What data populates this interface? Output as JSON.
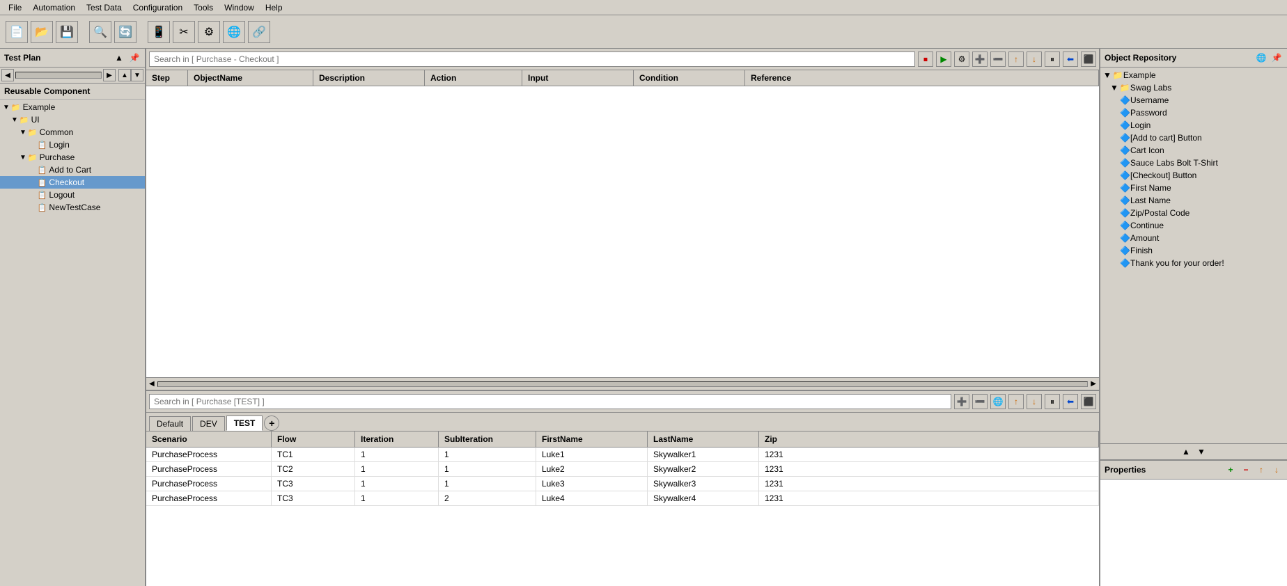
{
  "menu": {
    "items": [
      "File",
      "Automation",
      "Test Data",
      "Configuration",
      "Tools",
      "Window",
      "Help"
    ]
  },
  "toolbar": {
    "buttons": [
      "new",
      "open",
      "save",
      "magnify",
      "refresh",
      "device",
      "crop",
      "gear",
      "globe",
      "link"
    ]
  },
  "left_panel": {
    "title": "Test Plan",
    "label": "Reusable Component",
    "tree": [
      {
        "id": "example",
        "label": "Example",
        "level": 0,
        "type": "folder",
        "expand": true
      },
      {
        "id": "ui",
        "label": "UI",
        "level": 1,
        "type": "folder",
        "expand": true
      },
      {
        "id": "common",
        "label": "Common",
        "level": 2,
        "type": "folder",
        "expand": true
      },
      {
        "id": "login",
        "label": "Login",
        "level": 3,
        "type": "page"
      },
      {
        "id": "purchase",
        "label": "Purchase",
        "level": 2,
        "type": "folder",
        "expand": true
      },
      {
        "id": "addtocart",
        "label": "Add to Cart",
        "level": 3,
        "type": "page"
      },
      {
        "id": "checkout",
        "label": "Checkout",
        "level": 3,
        "type": "case",
        "selected": true
      },
      {
        "id": "logout",
        "label": "Logout",
        "level": 3,
        "type": "page"
      },
      {
        "id": "newtestcase",
        "label": "NewTestCase",
        "level": 3,
        "type": "page"
      }
    ]
  },
  "upper_section": {
    "search_placeholder": "Search in [",
    "search_context": "Purchase - Checkout",
    "search_context_suffix": " ]",
    "columns": [
      "Step",
      "ObjectName",
      "Description",
      "Action",
      "Input",
      "Condition",
      "Reference"
    ],
    "rows": []
  },
  "lower_section": {
    "search_placeholder": "Search in [",
    "search_context": "Purchase [TEST]",
    "search_context_suffix": " ]",
    "tabs": [
      {
        "label": "Default",
        "active": false
      },
      {
        "label": "DEV",
        "active": false
      },
      {
        "label": "TEST",
        "active": true
      }
    ],
    "columns": [
      "Scenario",
      "Flow",
      "Iteration",
      "SubIteration",
      "FirstName",
      "LastName",
      "Zip"
    ],
    "rows": [
      {
        "scenario": "PurchaseProcess",
        "flow": "TC1",
        "iteration": "1",
        "subiteration": "1",
        "firstname": "Luke1",
        "lastname": "Skywalker1",
        "zip": "1231"
      },
      {
        "scenario": "PurchaseProcess",
        "flow": "TC2",
        "iteration": "1",
        "subiteration": "1",
        "firstname": "Luke2",
        "lastname": "Skywalker2",
        "zip": "1231"
      },
      {
        "scenario": "PurchaseProcess",
        "flow": "TC3",
        "iteration": "1",
        "subiteration": "1",
        "firstname": "Luke3",
        "lastname": "Skywalker3",
        "zip": "1231"
      },
      {
        "scenario": "PurchaseProcess",
        "flow": "TC3",
        "iteration": "1",
        "subiteration": "2",
        "firstname": "Luke4",
        "lastname": "Skywalker4",
        "zip": "1231"
      }
    ]
  },
  "right_panel": {
    "title": "Object Repository",
    "tree": [
      {
        "label": "Example",
        "level": 0,
        "type": "folder",
        "expand": true
      },
      {
        "label": "Swag Labs",
        "level": 1,
        "type": "folder",
        "expand": true
      },
      {
        "label": "Username",
        "level": 2,
        "type": "obj"
      },
      {
        "label": "Password",
        "level": 2,
        "type": "obj"
      },
      {
        "label": "Login",
        "level": 2,
        "type": "obj"
      },
      {
        "label": "[Add to cart] Button",
        "level": 2,
        "type": "obj"
      },
      {
        "label": "Cart Icon",
        "level": 2,
        "type": "obj"
      },
      {
        "label": "Sauce Labs Bolt T-Shirt",
        "level": 2,
        "type": "obj"
      },
      {
        "label": "[Checkout] Button",
        "level": 2,
        "type": "obj"
      },
      {
        "label": "First Name",
        "level": 2,
        "type": "obj"
      },
      {
        "label": "Last Name",
        "level": 2,
        "type": "obj"
      },
      {
        "label": "Zip/Postal Code",
        "level": 2,
        "type": "obj"
      },
      {
        "label": "Continue",
        "level": 2,
        "type": "obj"
      },
      {
        "label": "Amount",
        "level": 2,
        "type": "obj"
      },
      {
        "label": "Finish",
        "level": 2,
        "type": "obj"
      },
      {
        "label": "Thank you for your order!",
        "level": 2,
        "type": "obj"
      }
    ],
    "properties_title": "Properties"
  }
}
